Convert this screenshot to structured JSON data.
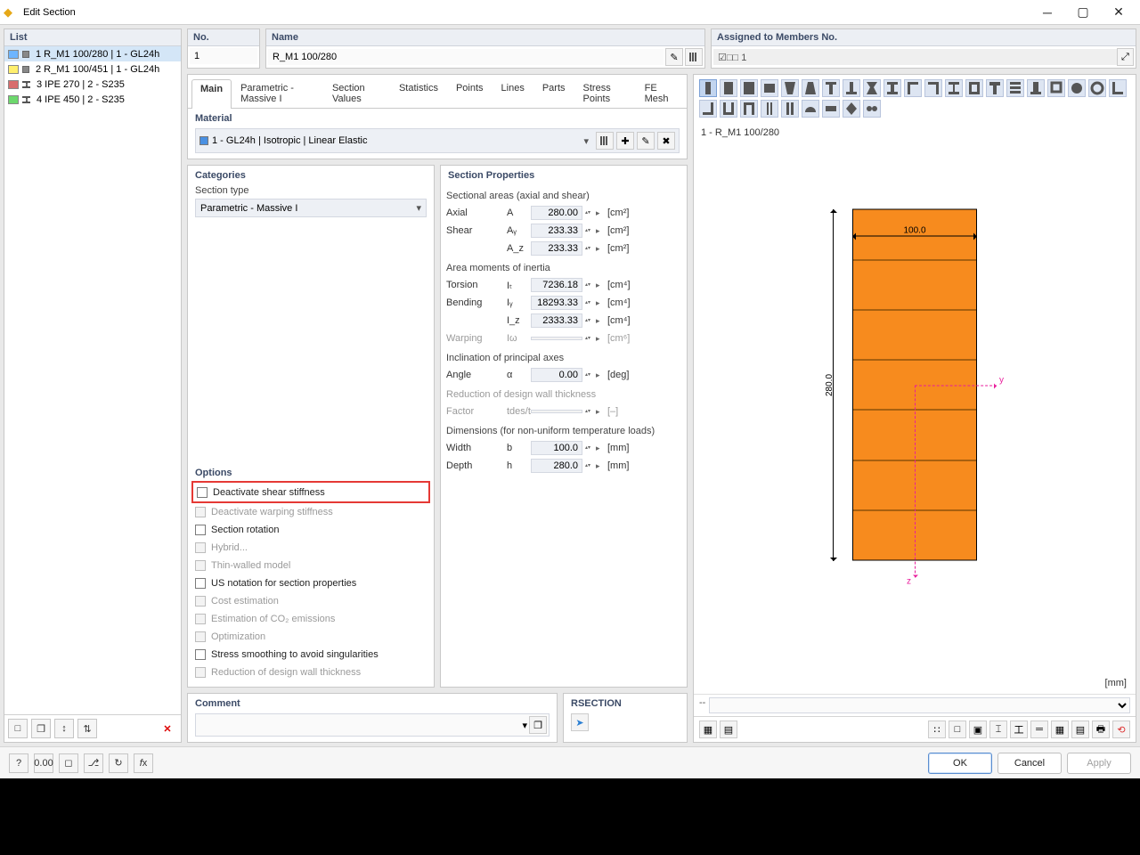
{
  "window": {
    "title": "Edit Section"
  },
  "list": {
    "header": "List",
    "items": [
      {
        "index": "1",
        "label": "R_M1 100/280 | 1 - GL24h",
        "color": "#6db5ff",
        "shape": "sq",
        "selected": true
      },
      {
        "index": "2",
        "label": "R_M1 100/451 | 1 - GL24h",
        "color": "#ffef6d",
        "shape": "sq",
        "selected": false
      },
      {
        "index": "3",
        "label": "IPE 270 | 2 - S235",
        "color": "#d86d6d",
        "shape": "i",
        "selected": false
      },
      {
        "index": "4",
        "label": "IPE 450 | 2 - S235",
        "color": "#6dd86d",
        "shape": "i",
        "selected": false
      }
    ]
  },
  "fields": {
    "no_hdr": "No.",
    "no_val": "1",
    "name_hdr": "Name",
    "name_val": "R_M1 100/280",
    "assigned_hdr": "Assigned to Members No.",
    "assigned_val": "☑□□ 1"
  },
  "tabs": [
    "Main",
    "Parametric - Massive I",
    "Section Values",
    "Statistics",
    "Points",
    "Lines",
    "Parts",
    "Stress Points",
    "FE Mesh"
  ],
  "active_tab": "Main",
  "material": {
    "hdr": "Material",
    "text": "1 - GL24h | Isotropic | Linear Elastic"
  },
  "categories": {
    "hdr": "Categories",
    "type_label": "Section type",
    "type_value": "Parametric - Massive I"
  },
  "options": {
    "hdr": "Options",
    "items": [
      {
        "label": "Deactivate shear stiffness",
        "enabled": true,
        "highlight": true
      },
      {
        "label": "Deactivate warping stiffness",
        "enabled": false
      },
      {
        "label": "Section rotation",
        "enabled": true
      },
      {
        "label": "Hybrid...",
        "enabled": false
      },
      {
        "label": "Thin-walled model",
        "enabled": false
      },
      {
        "label": "US notation for section properties",
        "enabled": true
      },
      {
        "label": "Cost estimation",
        "enabled": false
      },
      {
        "label": "Estimation of CO₂ emissions",
        "enabled": false
      },
      {
        "label": "Optimization",
        "enabled": false
      },
      {
        "label": "Stress smoothing to avoid singularities",
        "enabled": true
      },
      {
        "label": "Reduction of design wall thickness",
        "enabled": false
      }
    ]
  },
  "props": {
    "hdr": "Section Properties",
    "groups": [
      {
        "title": "Sectional areas (axial and shear)",
        "rows": [
          {
            "label": "Axial",
            "sym": "A",
            "val": "280.00",
            "unit": "[cm²]"
          },
          {
            "label": "Shear",
            "sym": "Aᵧ",
            "val": "233.33",
            "unit": "[cm²]"
          },
          {
            "label": "",
            "sym": "A_z",
            "val": "233.33",
            "unit": "[cm²]"
          }
        ]
      },
      {
        "title": "Area moments of inertia",
        "rows": [
          {
            "label": "Torsion",
            "sym": "Iₜ",
            "val": "7236.18",
            "unit": "[cm⁴]"
          },
          {
            "label": "Bending",
            "sym": "Iᵧ",
            "val": "18293.33",
            "unit": "[cm⁴]"
          },
          {
            "label": "",
            "sym": "I_z",
            "val": "2333.33",
            "unit": "[cm⁴]"
          },
          {
            "label": "Warping",
            "sym": "Iω",
            "val": "",
            "unit": "[cm⁶]",
            "disabled": true
          }
        ]
      },
      {
        "title": "Inclination of principal axes",
        "rows": [
          {
            "label": "Angle",
            "sym": "α",
            "val": "0.00",
            "unit": "[deg]"
          }
        ]
      },
      {
        "title": "Reduction of design wall thickness",
        "disabled": true,
        "rows": [
          {
            "label": "Factor",
            "sym": "tdes/t",
            "val": "",
            "unit": "[–]",
            "disabled": true
          }
        ]
      },
      {
        "title": "Dimensions (for non-uniform temperature loads)",
        "rows": [
          {
            "label": "Width",
            "sym": "b",
            "val": "100.0",
            "unit": "[mm]"
          },
          {
            "label": "Depth",
            "sym": "h",
            "val": "280.0",
            "unit": "[mm]"
          }
        ]
      }
    ]
  },
  "preview": {
    "label": "1 - R_M1 100/280",
    "width": "100.0",
    "height": "280.0",
    "unit": "[mm]"
  },
  "comment_hdr": "Comment",
  "rsection_hdr": "RSECTION",
  "buttons": {
    "ok": "OK",
    "cancel": "Cancel",
    "apply": "Apply"
  }
}
